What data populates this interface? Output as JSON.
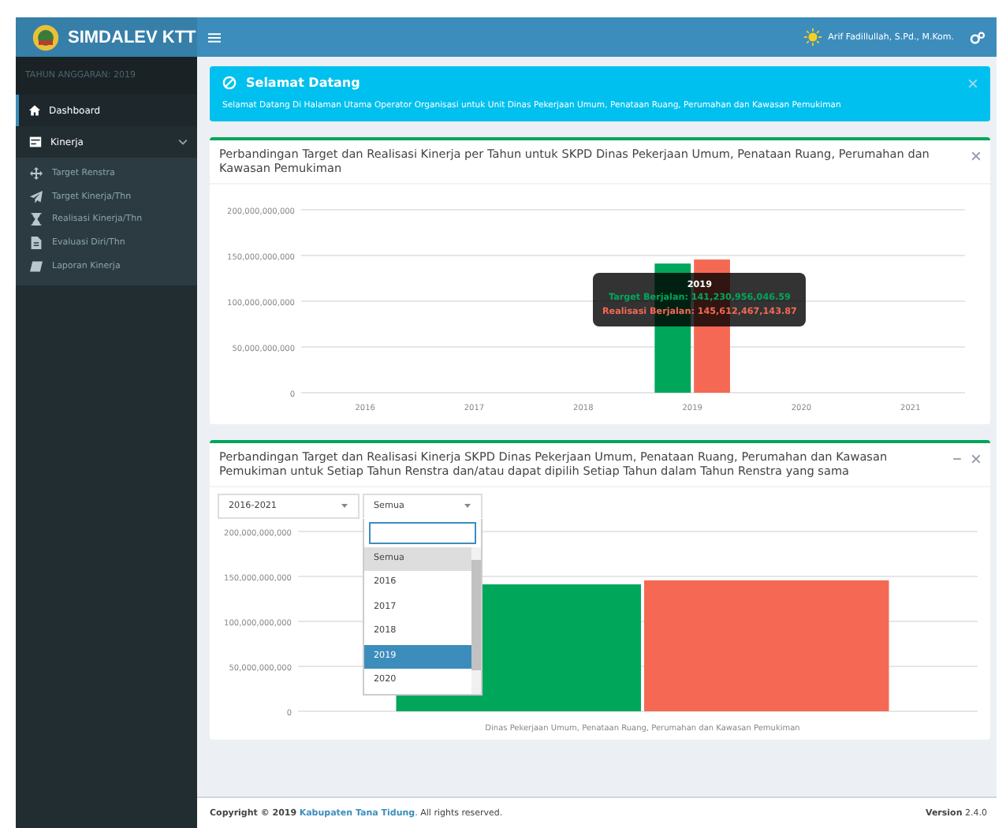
{
  "header": {
    "brand": "SIMDALEV KTT",
    "user": "Arif Fadillullah, S.Pd., M.Kom."
  },
  "sidebar": {
    "budget_year": "TAHUN ANGGARAN: 2019",
    "items": [
      {
        "label": "Dashboard",
        "selected": true
      },
      {
        "label": "Kinerja",
        "selected": false,
        "expanded": true,
        "children": [
          {
            "label": "Target Renstra",
            "selected": false
          },
          {
            "label": "Target Kinerja/Thn",
            "selected": false
          },
          {
            "label": "Realisasi Kinerja/Thn",
            "selected": false
          },
          {
            "label": "Evaluasi Diri/Thn",
            "selected": false
          },
          {
            "label": "Laporan Kinerja",
            "selected": false
          }
        ]
      }
    ]
  },
  "alert": {
    "title": "Selamat Datang",
    "message": "Selamat Datang Di Halaman Utama Operator Organisasi untuk Unit Dinas Pekerjaan Umum, Penataan Ruang, Perumahan dan Kawasan Pemukiman"
  },
  "panels": [
    {
      "title": "Perbandingan Target dan Realisasi Kinerja per Tahun untuk SKPD Dinas Pekerjaan Umum, Penataan Ruang, Perumahan dan Kawasan Pemukiman",
      "collapsible": false,
      "chart_data": {
        "type": "bar",
        "grid": true,
        "categories": [
          "2016",
          "2017",
          "2018",
          "2019",
          "2020",
          "2021"
        ],
        "series": [
          {
            "color": "#00a65a",
            "values": [
              null,
              null,
              null,
              141200000000,
              null,
              null
            ]
          },
          {
            "color": "#f56954",
            "values": [
              null,
              null,
              null,
              145600000000,
              null,
              null
            ]
          }
        ],
        "ylim": [
          0,
          200000000000
        ],
        "yticks": [
          {
            "value": 0,
            "label": "0"
          },
          {
            "value": 50000000000,
            "label": "50,000,000,000"
          },
          {
            "value": 100000000000,
            "label": "100,000,000,000"
          },
          {
            "value": 150000000000,
            "label": "150,000,000,000"
          },
          {
            "value": 200000000000,
            "label": "200,000,000,000"
          }
        ]
      },
      "tooltip": {
        "title": "2019",
        "lines": [
          "Target Berjalan: 141,230,956,046.59",
          "Realisasi Berjalan: 145,612,467,143.87"
        ]
      }
    },
    {
      "title": "Perbandingan Target dan Realisasi Kinerja SKPD Dinas Pekerjaan Umum, Penataan Ruang, Perumahan dan Kawasan Pemukiman untuk Setiap Tahun Renstra dan/atau dapat dipilih Setiap Tahun dalam Tahun Renstra yang sama",
      "collapsible": true,
      "selects": [
        {
          "value": "2016-2021",
          "open": false
        },
        {
          "value": "Semua",
          "open": true,
          "options": [
            {
              "label": "Semua",
              "selected": true,
              "hovered": false
            },
            {
              "label": "2016",
              "selected": false,
              "hovered": false
            },
            {
              "label": "2017",
              "selected": false,
              "hovered": false
            },
            {
              "label": "2018",
              "selected": false,
              "hovered": false
            },
            {
              "label": "2019",
              "selected": false,
              "hovered": true
            },
            {
              "label": "2020",
              "selected": false,
              "hovered": false
            }
          ]
        }
      ],
      "chart_data": {
        "type": "bar",
        "grid": true,
        "categories": [
          "Dinas Pekerjaan Umum, Penataan Ruang, Perumahan dan Kawasan Pemukiman"
        ],
        "series": [
          {
            "color": "#00a65a",
            "values": [
              141200000000
            ]
          },
          {
            "color": "#f56954",
            "values": [
              145600000000
            ]
          }
        ],
        "ylim": [
          0,
          200000000000
        ],
        "yticks": [
          {
            "value": 0,
            "label": "0"
          },
          {
            "value": 50000000000,
            "label": "50,000,000,000"
          },
          {
            "value": 100000000000,
            "label": "100,000,000,000"
          },
          {
            "value": 150000000000,
            "label": "150,000,000,000"
          },
          {
            "value": 200000000000,
            "label": "200,000,000,000"
          }
        ]
      }
    }
  ],
  "footer": {
    "copyright_prefix": "Copyright © 2019",
    "link": "Kabupaten Tana Tidung",
    "copyright_suffix": ". All rights reserved.",
    "version_label": "Version",
    "version": "2.4.0"
  }
}
